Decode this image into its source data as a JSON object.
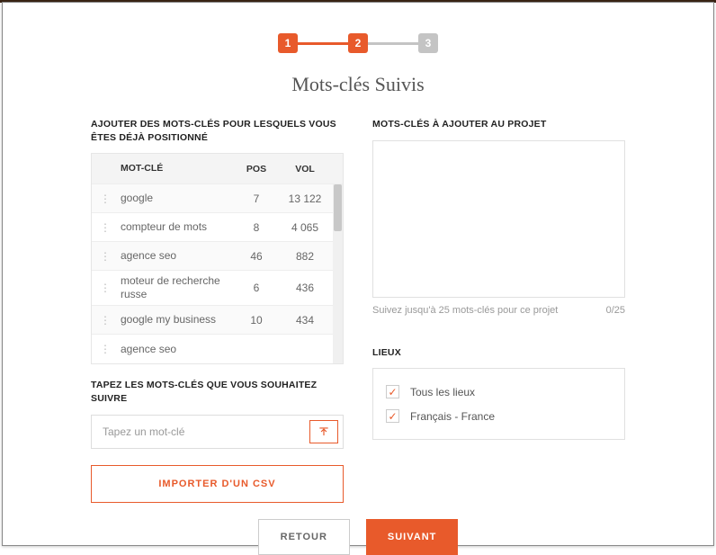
{
  "stepper": {
    "steps": [
      "1",
      "2",
      "3"
    ],
    "active_until": 2
  },
  "page_title": "Mots-clés Suivis",
  "left": {
    "addRankedLabel": "AJOUTER DES MOTS-CLÉS POUR LESQUELS VOUS ÊTES DÉJÀ POSITIONNÉ",
    "table": {
      "headers": {
        "keyword": "MOT-CLÉ",
        "pos": "POS",
        "vol": "VOL"
      },
      "rows": [
        {
          "kw": "google",
          "pos": "7",
          "vol": "13 122"
        },
        {
          "kw": "compteur de mots",
          "pos": "8",
          "vol": "4 065"
        },
        {
          "kw": "agence seo",
          "pos": "46",
          "vol": "882"
        },
        {
          "kw": "moteur de recherche russe",
          "pos": "6",
          "vol": "436"
        },
        {
          "kw": "google my business",
          "pos": "10",
          "vol": "434"
        },
        {
          "kw": "agence seo",
          "pos": "",
          "vol": ""
        }
      ]
    },
    "typeLabel": "TAPEZ LES MOTS-CLÉS QUE VOUS SOUHAITEZ SUIVRE",
    "inputPlaceholder": "Tapez un mot-clé",
    "importBtn": "IMPORTER D'UN CSV"
  },
  "right": {
    "addToProjectLabel": "MOTS-CLÉS À AJOUTER AU PROJET",
    "helper": "Suivez jusqu'à 25 mots-clés pour ce projet",
    "counter": "0/25",
    "lieuxLabel": "LIEUX",
    "lieux": [
      {
        "label": "Tous les lieux",
        "checked": true
      },
      {
        "label": "Français - France",
        "checked": true
      }
    ]
  },
  "footer": {
    "back": "RETOUR",
    "next": "SUIVANT"
  }
}
